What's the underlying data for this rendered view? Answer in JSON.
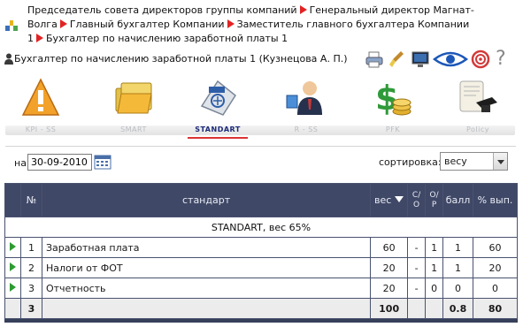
{
  "breadcrumb": {
    "items": [
      "Председатель совета директоров группы компаний",
      "Генеральный директор Магнат-Волга",
      "Главный бухгалтер Компании",
      "Заместитель главного бухгалтера Компании 1",
      "Бухгалтер по начислению заработной платы 1"
    ]
  },
  "user": {
    "label": "Бухгалтер по начислению заработной платы 1  (Кузнецова А. П.)"
  },
  "toolbar": {
    "icons": [
      "print-icon",
      "brush-icon",
      "monitor-icon",
      "eye-icon",
      "target-icon",
      "help-icon"
    ],
    "help_glyph": "?"
  },
  "modules": [
    {
      "label": "KPI - SS",
      "icon": "kpi-icon"
    },
    {
      "label": "SMART",
      "icon": "folders-icon"
    },
    {
      "label": "STANDART",
      "icon": "goal-icon",
      "active": true
    },
    {
      "label": "R - SS",
      "icon": "person-numbers-icon"
    },
    {
      "label": "PFK",
      "icon": "money-icon"
    },
    {
      "label": "Policy",
      "icon": "graduation-icon"
    }
  ],
  "filters": {
    "date_label": "на",
    "date_value": "30-09-2010",
    "sort_label": "сортировка:",
    "sort_value": "весу"
  },
  "table": {
    "headers": {
      "num": "№",
      "standard": "стандарт",
      "weight": "вес",
      "co_top": "С/",
      "co_bottom": "О",
      "op_top": "О/",
      "op_bottom": "Р",
      "score": "балл",
      "percent": "% вып."
    },
    "group": "STANDART, вес 65%",
    "rows": [
      {
        "num": "1",
        "name": "Заработная плата",
        "weight": "60",
        "co": "-",
        "op": "1",
        "score": "1",
        "percent": "60"
      },
      {
        "num": "2",
        "name": "Налоги от ФОТ",
        "weight": "20",
        "co": "-",
        "op": "1",
        "score": "1",
        "percent": "20"
      },
      {
        "num": "3",
        "name": "Отчетность",
        "weight": "20",
        "co": "-",
        "op": "0",
        "score": "0",
        "percent": "0"
      }
    ],
    "total": {
      "num": "3",
      "weight": "100",
      "score": "0.8",
      "percent": "80"
    }
  },
  "colors": {
    "accent_red": "#e22323",
    "header_bg": "#3f4866",
    "play_green": "#2d9b31"
  }
}
